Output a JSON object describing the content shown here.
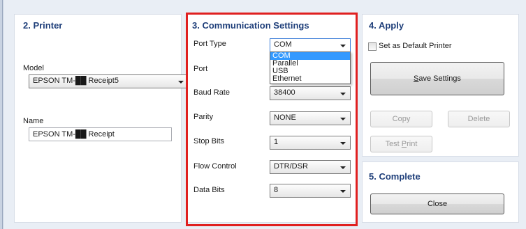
{
  "printer": {
    "title": "2. Printer",
    "model_label": "Model",
    "model_value": "EPSON TM-██ Receipt5",
    "name_label": "Name",
    "name_value": "EPSON TM-██ Receipt"
  },
  "comm": {
    "title": "3. Communication Settings",
    "port_type_label": "Port Type",
    "port_type_value": "COM",
    "port_type_options": [
      "COM",
      "Parallel",
      "USB",
      "Ethernet"
    ],
    "port_label": "Port",
    "baud_label": "Baud Rate",
    "baud_value": "38400",
    "parity_label": "Parity",
    "parity_value": "NONE",
    "stop_bits_label": "Stop Bits",
    "stop_bits_value": "1",
    "flow_label": "Flow Control",
    "flow_value": "DTR/DSR",
    "data_bits_label": "Data Bits",
    "data_bits_value": "8"
  },
  "apply": {
    "title": "4. Apply",
    "default_printer_label": "Set as Default Printer",
    "save_pre": "",
    "save_key": "S",
    "save_post": "ave Settings",
    "copy_label": "Copy",
    "delete_label": "Delete",
    "test_pre": "Test ",
    "test_key": "P",
    "test_post": "rint"
  },
  "complete": {
    "title": "5. Complete",
    "close_label": "Close"
  },
  "colors": {
    "title_color": "#1f3f7a",
    "highlight": "#e02020",
    "selection": "#3399ff"
  }
}
